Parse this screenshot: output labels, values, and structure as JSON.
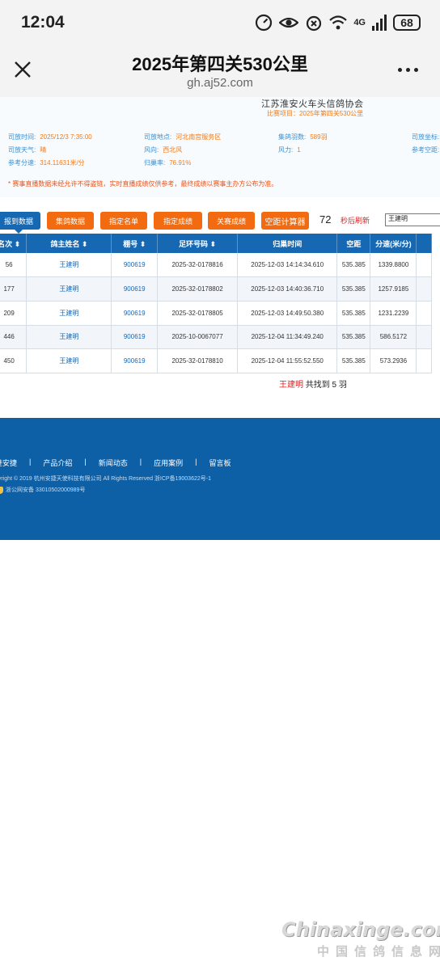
{
  "status_bar": {
    "time": "12:04",
    "network": "4G",
    "battery": "68"
  },
  "browser": {
    "title": "2025年第四关530公里",
    "url": "gh.aj52.com"
  },
  "race_info": {
    "association": "江苏淮安火车头信鸽协会",
    "project": "比赛项目：2025年第四关530公里",
    "fields": [
      {
        "label": "司放时间:",
        "value": "2025/12/3 7:35:00"
      },
      {
        "label": "司放地点:",
        "value": "河北南宫服务区"
      },
      {
        "label": "集鸽羽数:",
        "value": "589羽"
      },
      {
        "label": "司放坐标:",
        "value": ""
      },
      {
        "label": "司放天气:",
        "value": "晴"
      },
      {
        "label": "风向:",
        "value": "西北风"
      },
      {
        "label": "风力:",
        "value": "1"
      },
      {
        "label": "参考空距:",
        "value": ""
      },
      {
        "label": "参考分速:",
        "value": "314.11631米/分"
      },
      {
        "label": "归巢率:",
        "value": "76.91%"
      }
    ],
    "notice": "* 赛事直播数据未经允许不得盗链，实时直播成绩仅供参考，最终成绩以赛事主办方公布为准。"
  },
  "toolbar": {
    "buttons": [
      "报到数据",
      "集鸽数据",
      "指定名单",
      "指定成绩",
      "关赛成绩",
      "空距计算器"
    ],
    "countdown": "72",
    "refresh_label": "秒后刷新",
    "search_value": "王建明"
  },
  "table": {
    "headers": [
      "名次",
      "鸽主姓名",
      "棚号",
      "足环号码",
      "归巢时间",
      "空距",
      "分速(米/分)"
    ],
    "rows": [
      [
        "56",
        "王建明",
        "900619",
        "2025-32-0178816",
        "2025-12-03 14:14:34.610",
        "535.385",
        "1339.8800"
      ],
      [
        "177",
        "王建明",
        "900619",
        "2025-32-0178802",
        "2025-12-03 14:40:36.710",
        "535.385",
        "1257.9185"
      ],
      [
        "209",
        "王建明",
        "900619",
        "2025-32-0178805",
        "2025-12-03 14:49:50.380",
        "535.385",
        "1231.2239"
      ],
      [
        "446",
        "王建明",
        "900619",
        "2025-10-0067077",
        "2025-12-04 11:34:49.240",
        "535.385",
        "586.5172"
      ],
      [
        "450",
        "王建明",
        "900619",
        "2025-32-0178810",
        "2025-12-04 11:55:52.550",
        "535.385",
        "573.2936"
      ]
    ],
    "summary_name": "王建明",
    "summary_text": " 共找到 5 羽"
  },
  "footer": {
    "nav": [
      "进安捷",
      "产品介绍",
      "新闻动态",
      "应用案例",
      "留言板"
    ],
    "separator": "|",
    "copyright": "pyright © 2019 杭州安捷天使科技有限公司 All Rights Reserved 浙ICP备19003622号-1",
    "police": "浙公网安备 33010502000989号"
  },
  "watermark": {
    "main": "Chinaxinge.com",
    "sub": "中国信鸽信息网"
  },
  "colors": {
    "primary_blue": "#1768b3",
    "accent_orange": "#f26b10",
    "alert_red": "#e02020",
    "footer_blue": "#0d5fa6"
  }
}
